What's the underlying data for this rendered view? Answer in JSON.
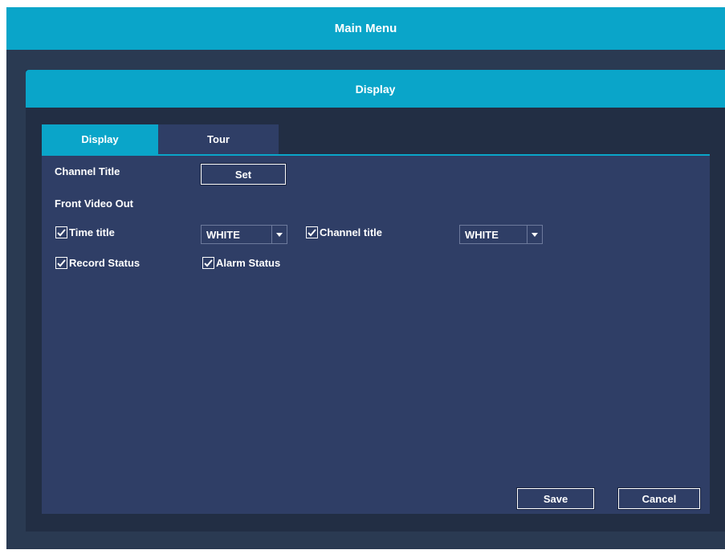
{
  "main_menu": {
    "title": "Main Menu"
  },
  "window": {
    "title": "Display"
  },
  "tabs": [
    {
      "label": "Display",
      "active": true
    },
    {
      "label": "Tour",
      "active": false
    }
  ],
  "settings": {
    "channel_title_label": "Channel Title",
    "channel_title_button": "Set",
    "front_video_out_label": "Front Video Out",
    "time_title": {
      "label": "Time title",
      "checked": true,
      "color": "WHITE"
    },
    "channel_title": {
      "label": "Channel title",
      "checked": true,
      "color": "WHITE"
    },
    "record_status": {
      "label": "Record Status",
      "checked": true
    },
    "alarm_status": {
      "label": "Alarm Status",
      "checked": true
    }
  },
  "actions": {
    "save": "Save",
    "cancel": "Cancel"
  },
  "colors": {
    "accent": "#0aa5c9",
    "panel": "#2f3e66",
    "background": "#2a3a52"
  },
  "icons": {
    "checkbox": "check-icon",
    "dropdown": "caret-down-icon"
  }
}
